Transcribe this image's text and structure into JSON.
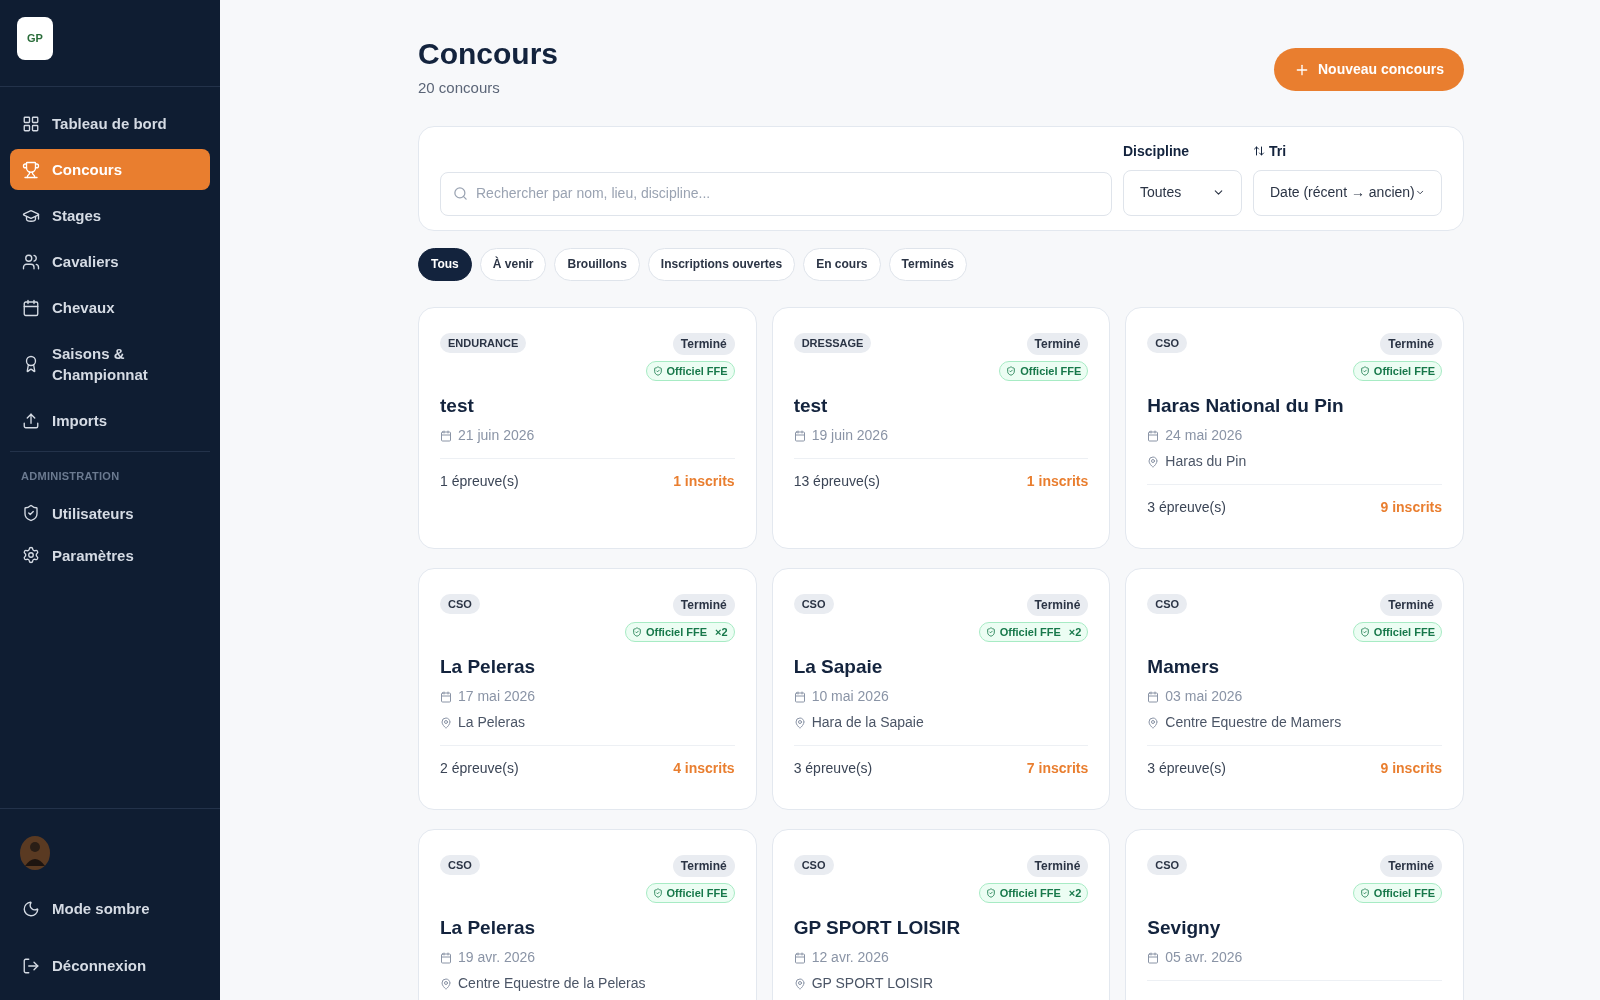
{
  "sidebar": {
    "logo": "GP",
    "items": [
      {
        "label": "Tableau de bord",
        "selected": false
      },
      {
        "label": "Concours",
        "selected": true
      },
      {
        "label": "Stages",
        "selected": false
      },
      {
        "label": "Cavaliers",
        "selected": false
      },
      {
        "label": "Chevaux",
        "selected": false
      },
      {
        "label": "Saisons & Championnat",
        "selected": false
      },
      {
        "label": "Imports",
        "selected": false
      }
    ],
    "section_title": "ADMINISTRATION",
    "admin_items": [
      {
        "label": "Utilisateurs",
        "selected": false
      },
      {
        "label": "Paramètres",
        "selected": false
      }
    ],
    "footer_items": [
      {
        "label": "Mode sombre"
      },
      {
        "label": "Déconnexion"
      }
    ]
  },
  "header": {
    "title": "Concours",
    "subtitle": "20 concours",
    "new_button": "Nouveau concours"
  },
  "filters": {
    "search": {
      "placeholder": "Rechercher par nom, lieu, discipline..."
    },
    "discipline": {
      "label": "Discipline",
      "value": "Toutes"
    },
    "sort": {
      "label": "Tri",
      "value": "Date (récent → ancien)"
    }
  },
  "status_tabs": [
    {
      "label": "Tous",
      "selected": true
    },
    {
      "label": "À venir",
      "selected": false
    },
    {
      "label": "Brouillons",
      "selected": false
    },
    {
      "label": "Inscriptions ouvertes",
      "selected": false
    },
    {
      "label": "En cours",
      "selected": false
    },
    {
      "label": "Terminés",
      "selected": false
    }
  ],
  "cards": [
    {
      "discipline": "ENDURANCE",
      "status": "Terminé",
      "official": "Officiel FFE",
      "title": "test",
      "date": "21 juin 2026",
      "epreuves": "1 épreuve(s)",
      "inscrits": "1 inscrits"
    },
    {
      "discipline": "DRESSAGE",
      "status": "Terminé",
      "official": "Officiel FFE",
      "title": "test",
      "date": "19 juin 2026",
      "epreuves": "13 épreuve(s)",
      "inscrits": "1 inscrits"
    },
    {
      "discipline": "CSO",
      "status": "Terminé",
      "official": "Officiel FFE",
      "title": "Haras National du Pin",
      "date": "24 mai 2026",
      "location": "Haras du Pin",
      "epreuves": "3 épreuve(s)",
      "inscrits": "9 inscrits"
    },
    {
      "discipline": "CSO",
      "status": "Terminé",
      "official": "Officiel FFE",
      "official_count": "×2",
      "title": "La Peleras",
      "date": "17 mai 2026",
      "location": "La Peleras",
      "epreuves": "2 épreuve(s)",
      "inscrits": "4 inscrits"
    },
    {
      "discipline": "CSO",
      "status": "Terminé",
      "official": "Officiel FFE",
      "official_count": "×2",
      "title": "La Sapaie",
      "date": "10 mai 2026",
      "location": "Hara de la Sapaie",
      "epreuves": "3 épreuve(s)",
      "inscrits": "7 inscrits"
    },
    {
      "discipline": "CSO",
      "status": "Terminé",
      "official": "Officiel FFE",
      "title": "Mamers",
      "date": "03 mai 2026",
      "location": "Centre Equestre de Mamers",
      "epreuves": "3 épreuve(s)",
      "inscrits": "9 inscrits"
    },
    {
      "discipline": "CSO",
      "status": "Terminé",
      "official": "Officiel FFE",
      "title": "La Peleras",
      "date": "19 avr. 2026",
      "location": "Centre Equestre de la Peleras"
    },
    {
      "discipline": "CSO",
      "status": "Terminé",
      "official": "Officiel FFE",
      "official_count": "×2",
      "title": "GP SPORT LOISIR",
      "date": "12 avr. 2026",
      "location": "GP SPORT LOISIR"
    },
    {
      "discipline": "CSO",
      "status": "Terminé",
      "official": "Officiel FFE",
      "title": "Sevigny",
      "date": "05 avr. 2026"
    }
  ]
}
